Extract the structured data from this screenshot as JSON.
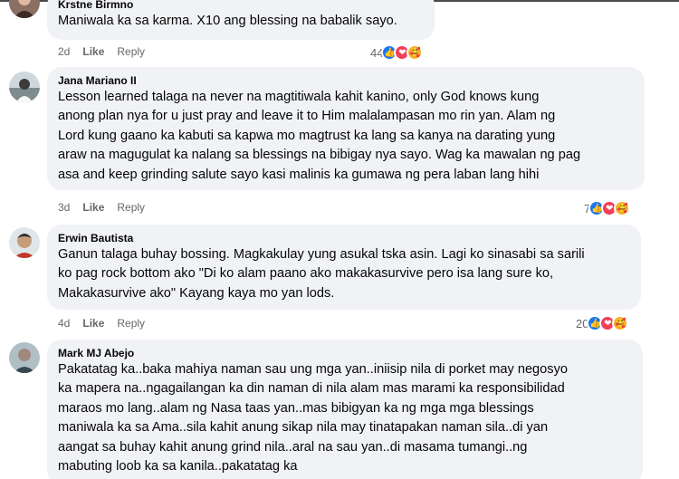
{
  "comments": [
    {
      "author": "Krstne Birmno",
      "text": "Maniwala ka sa karma. X10 ang blessing na babalik sayo.",
      "time": "2d",
      "like_label": "Like",
      "reply_label": "Reply",
      "reaction_count": "44",
      "reaction_icons": [
        "like-icon",
        "love-icon",
        "care-icon"
      ]
    },
    {
      "author": "Jana Mariano II",
      "text": "Lesson learned talaga na never na magtitiwala kahit kanino, only God knows kung\nanong plan nya for u just pray and leave it to Him malalampasan mo rin yan. Alam ng\nLord kung gaano ka kabuti sa kapwa mo magtrust ka lang sa kanya na darating yung\naraw na magugulat ka nalang sa blessings na bibigay nya sayo. Wag ka mawalan ng pag\nasa and keep grinding salute sayo kasi malinis ka gumawa ng pera laban lang hihi",
      "time": "3d",
      "like_label": "Like",
      "reply_label": "Reply",
      "reaction_count": "7",
      "reaction_icons": [
        "like-icon",
        "love-icon",
        "care-icon"
      ]
    },
    {
      "author": "Erwin Bautista",
      "text": "Ganun talaga buhay bossing. Magkakulay yung asukal tska asin. Lagi ko sinasabi sa sarili\nko pag rock bottom ako \"Di ko alam paano ako makakasurvive pero isa lang sure ko,\nMakakasurvive ako\" Kayang kaya mo yan lods.",
      "time": "4d",
      "like_label": "Like",
      "reply_label": "Reply",
      "reaction_count": "20",
      "reaction_icons": [
        "like-icon",
        "love-icon",
        "care-icon"
      ]
    },
    {
      "author": "Mark MJ Abejo",
      "text": "Pakatatag ka..baka mahiya naman sau ung mga yan..iniisip nila di porket may negosyo\nka mapera na..ngagailangan ka din naman di nila alam mas marami ka responsibilidad\nmaraos mo lang..alam ng Nasa taas yan..mas bibigyan ka ng mga mga blessings\nmaniwala ka sa Ama..sila kahit anung sikap nila may tinatapakan naman sila..di yan\naangat sa buhay kahit anung grind nila..aral na sau yan..di masama tumangi..ng\nmabuting loob ka sa kanila..pakatatag ka",
      "time": "",
      "like_label": "",
      "reply_label": "",
      "reaction_count": "",
      "reaction_icons": []
    }
  ]
}
